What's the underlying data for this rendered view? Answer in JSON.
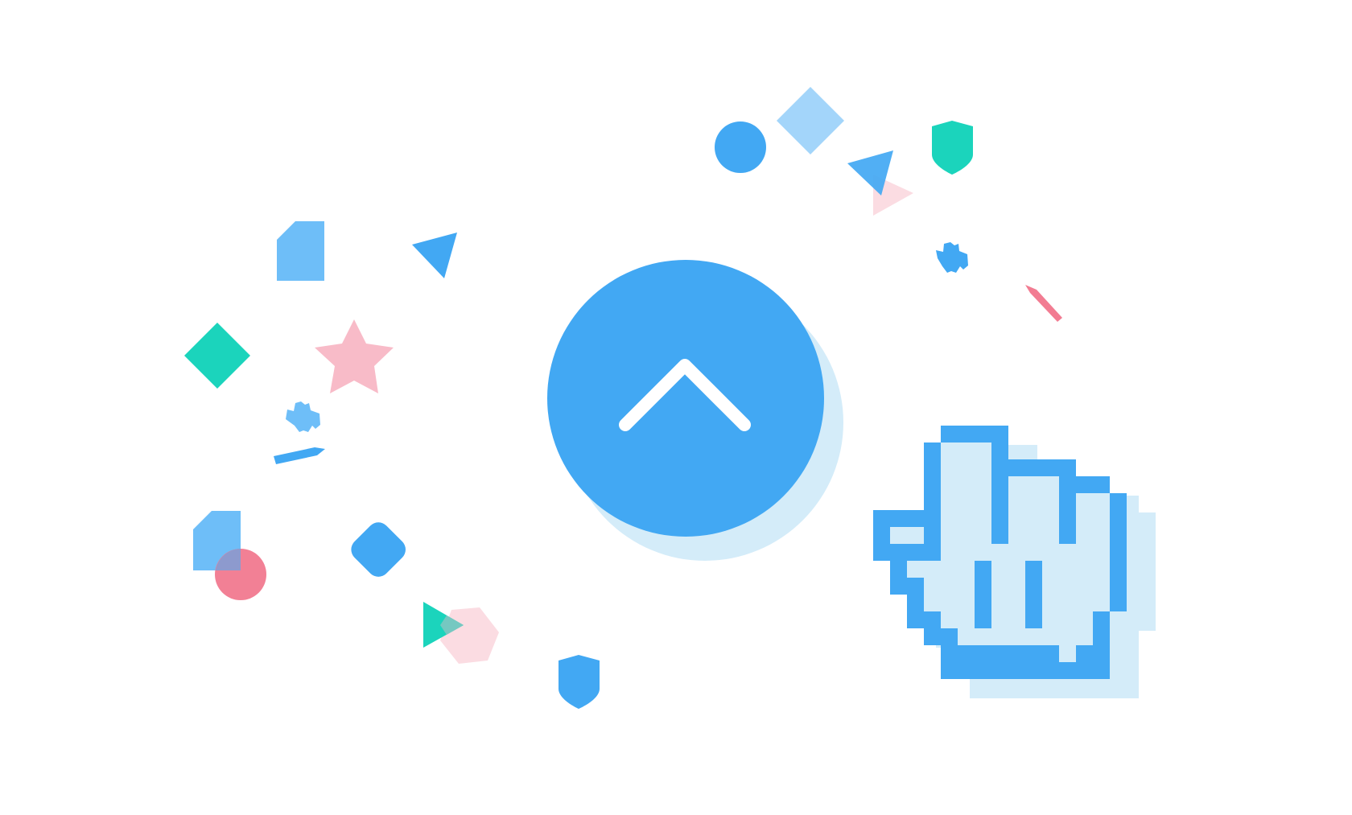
{
  "illustration": {
    "main_button_icon": "chevron-up-icon",
    "cursor_icon": "pixel-hand-cursor-icon",
    "colors": {
      "blue": "#42A8F3",
      "light_blue": "#6EBEF8",
      "pale_blue": "#A3D5FA",
      "shadow_blue": "#D4ECF9",
      "teal": "#1BD4BC",
      "pink": "#F8BBC8",
      "pale_pink": "#FBDCE2",
      "red": "#F27C92",
      "white": "#FFFFFF"
    },
    "confetti": [
      "circle",
      "diamond",
      "triangle",
      "triangle",
      "shield",
      "gear",
      "pencil",
      "folded-square",
      "triangle",
      "diamond",
      "star",
      "gear",
      "pencil",
      "folded-square",
      "circle",
      "rounded-diamond",
      "triangle",
      "hexagon",
      "shield"
    ]
  }
}
